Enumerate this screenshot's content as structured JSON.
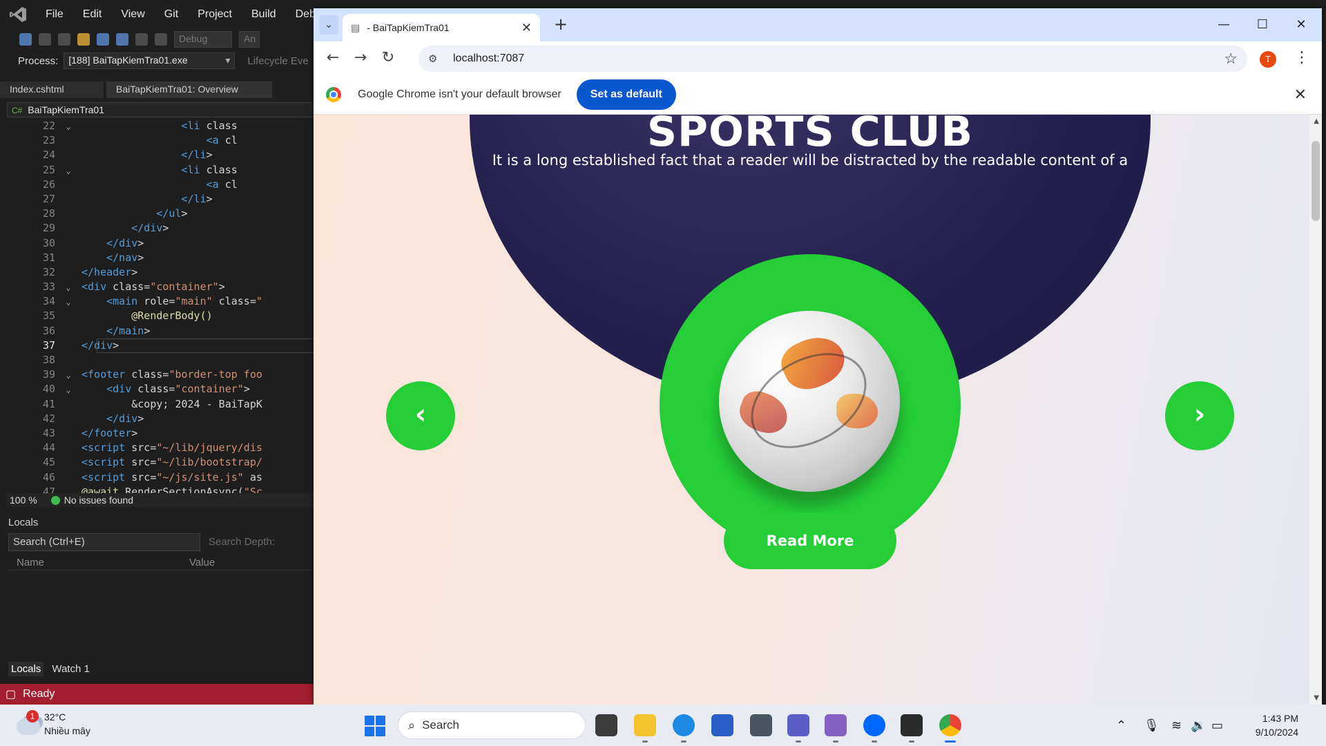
{
  "vs": {
    "menu": [
      "File",
      "Edit",
      "View",
      "Git",
      "Project",
      "Build",
      "Debug"
    ],
    "toolbar": {
      "config": "Debug",
      "platform": "An"
    },
    "process_label": "Process:",
    "process_value": "[188] BaiTapKiemTra01.exe",
    "lifecycle": "Lifecycle Eve",
    "tabs": [
      "Index.cshtml",
      "BaiTapKiemTra01: Overview"
    ],
    "nav_project": "BaiTapKiemTra01",
    "code_lines": [
      {
        "n": "22",
        "fold": "⌄",
        "html": "                <li class"
      },
      {
        "n": "23",
        "fold": "",
        "html": "                    <a cl"
      },
      {
        "n": "24",
        "fold": "",
        "html": "                </li>"
      },
      {
        "n": "25",
        "fold": "⌄",
        "html": "                <li class"
      },
      {
        "n": "26",
        "fold": "",
        "html": "                    <a cl"
      },
      {
        "n": "27",
        "fold": "",
        "html": "                </li>"
      },
      {
        "n": "28",
        "fold": "",
        "html": "            </ul>"
      },
      {
        "n": "29",
        "fold": "",
        "html": "        </div>"
      },
      {
        "n": "30",
        "fold": "",
        "html": "    </div>"
      },
      {
        "n": "31",
        "fold": "",
        "html": "    </nav>"
      },
      {
        "n": "32",
        "fold": "",
        "html": "</header>"
      },
      {
        "n": "33",
        "fold": "⌄",
        "html": "<div class=\"container\">"
      },
      {
        "n": "34",
        "fold": "⌄",
        "html": "    <main role=\"main\" class=\""
      },
      {
        "n": "35",
        "fold": "",
        "html": "        @RenderBody()"
      },
      {
        "n": "36",
        "fold": "",
        "html": "    </main>"
      },
      {
        "n": "37",
        "fold": "",
        "html": "</div>"
      },
      {
        "n": "38",
        "fold": "",
        "html": ""
      },
      {
        "n": "39",
        "fold": "⌄",
        "html": "<footer class=\"border-top foo"
      },
      {
        "n": "40",
        "fold": "⌄",
        "html": "    <div class=\"container\">"
      },
      {
        "n": "41",
        "fold": "",
        "html": "        &copy; 2024 - BaiTapK"
      },
      {
        "n": "42",
        "fold": "",
        "html": "    </div>"
      },
      {
        "n": "43",
        "fold": "",
        "html": "</footer>"
      },
      {
        "n": "44",
        "fold": "",
        "html": "<script src=\"~/lib/jquery/dis"
      },
      {
        "n": "45",
        "fold": "",
        "html": "<script src=\"~/lib/bootstrap/"
      },
      {
        "n": "46",
        "fold": "",
        "html": "<script src=\"~/js/site.js\" as"
      },
      {
        "n": "47",
        "fold": "",
        "html": "@await RenderSectionAsync(\"Sc"
      }
    ],
    "zoom": "100 %",
    "issues": "No issues found",
    "locals_title": "Locals",
    "locals_search": "Search (Ctrl+E)",
    "search_depth": "Search Depth:",
    "col_name": "Name",
    "col_value": "Value",
    "bottom_tabs": [
      "Locals",
      "Watch 1"
    ],
    "status": "Ready"
  },
  "chrome": {
    "tab_title": "- BaiTapKiemTra01",
    "url": "localhost:7087",
    "profile_initial": "T",
    "infobar_text": "Google Chrome isn't your default browser",
    "set_default": "Set as default"
  },
  "page": {
    "title": "SPORTS CLUB",
    "subtitle": "It is a long established fact that a reader will be distracted by the readable content of a",
    "read_more": "Read More",
    "prev": "‹",
    "next": "›",
    "accent": "#25cd37",
    "dark": "#25214f"
  },
  "taskbar": {
    "weather_temp": "32°C",
    "weather_desc": "Nhiều mây",
    "weather_badge": "1",
    "search": "Search",
    "time": "1:43 PM",
    "date": "9/10/2024"
  }
}
